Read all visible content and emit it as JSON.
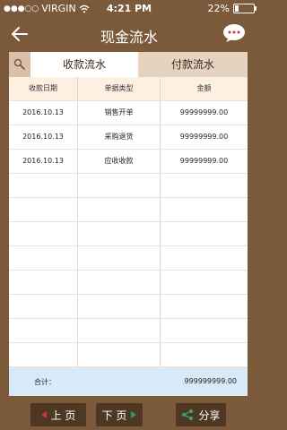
{
  "status_bar": {
    "carrier": "VIRGIN",
    "time": "4:21 PM",
    "battery": "22%",
    "battery_level": 0.22
  },
  "nav": {
    "title": "现金流水",
    "back_icon": "back-arrow-icon",
    "message_icon": "chat-bubble-icon"
  },
  "tabs": [
    {
      "label": "收款流水",
      "active": true
    },
    {
      "label": "付款流水",
      "active": false
    }
  ],
  "table": {
    "headers": [
      "收款日期",
      "单据类型",
      "金额"
    ],
    "rows": [
      [
        "2016.10.13",
        "销售开单",
        "99999999.00"
      ],
      [
        "2016.10.13",
        "采购退货",
        "99999999.00"
      ],
      [
        "2016.10.13",
        "应收收款",
        "99999999.00"
      ]
    ]
  },
  "total": {
    "label": "合计：",
    "value": "999999999.00"
  },
  "footer": {
    "prev_label": "上 页",
    "next_label": "下 页",
    "share_label": "分享"
  },
  "colors": {
    "background": "#7a5a3b",
    "tab_bar": "#e5d2c1",
    "header_row": "#fdf0e1",
    "total_row": "#d8e9f7",
    "button": "#4e3824"
  }
}
